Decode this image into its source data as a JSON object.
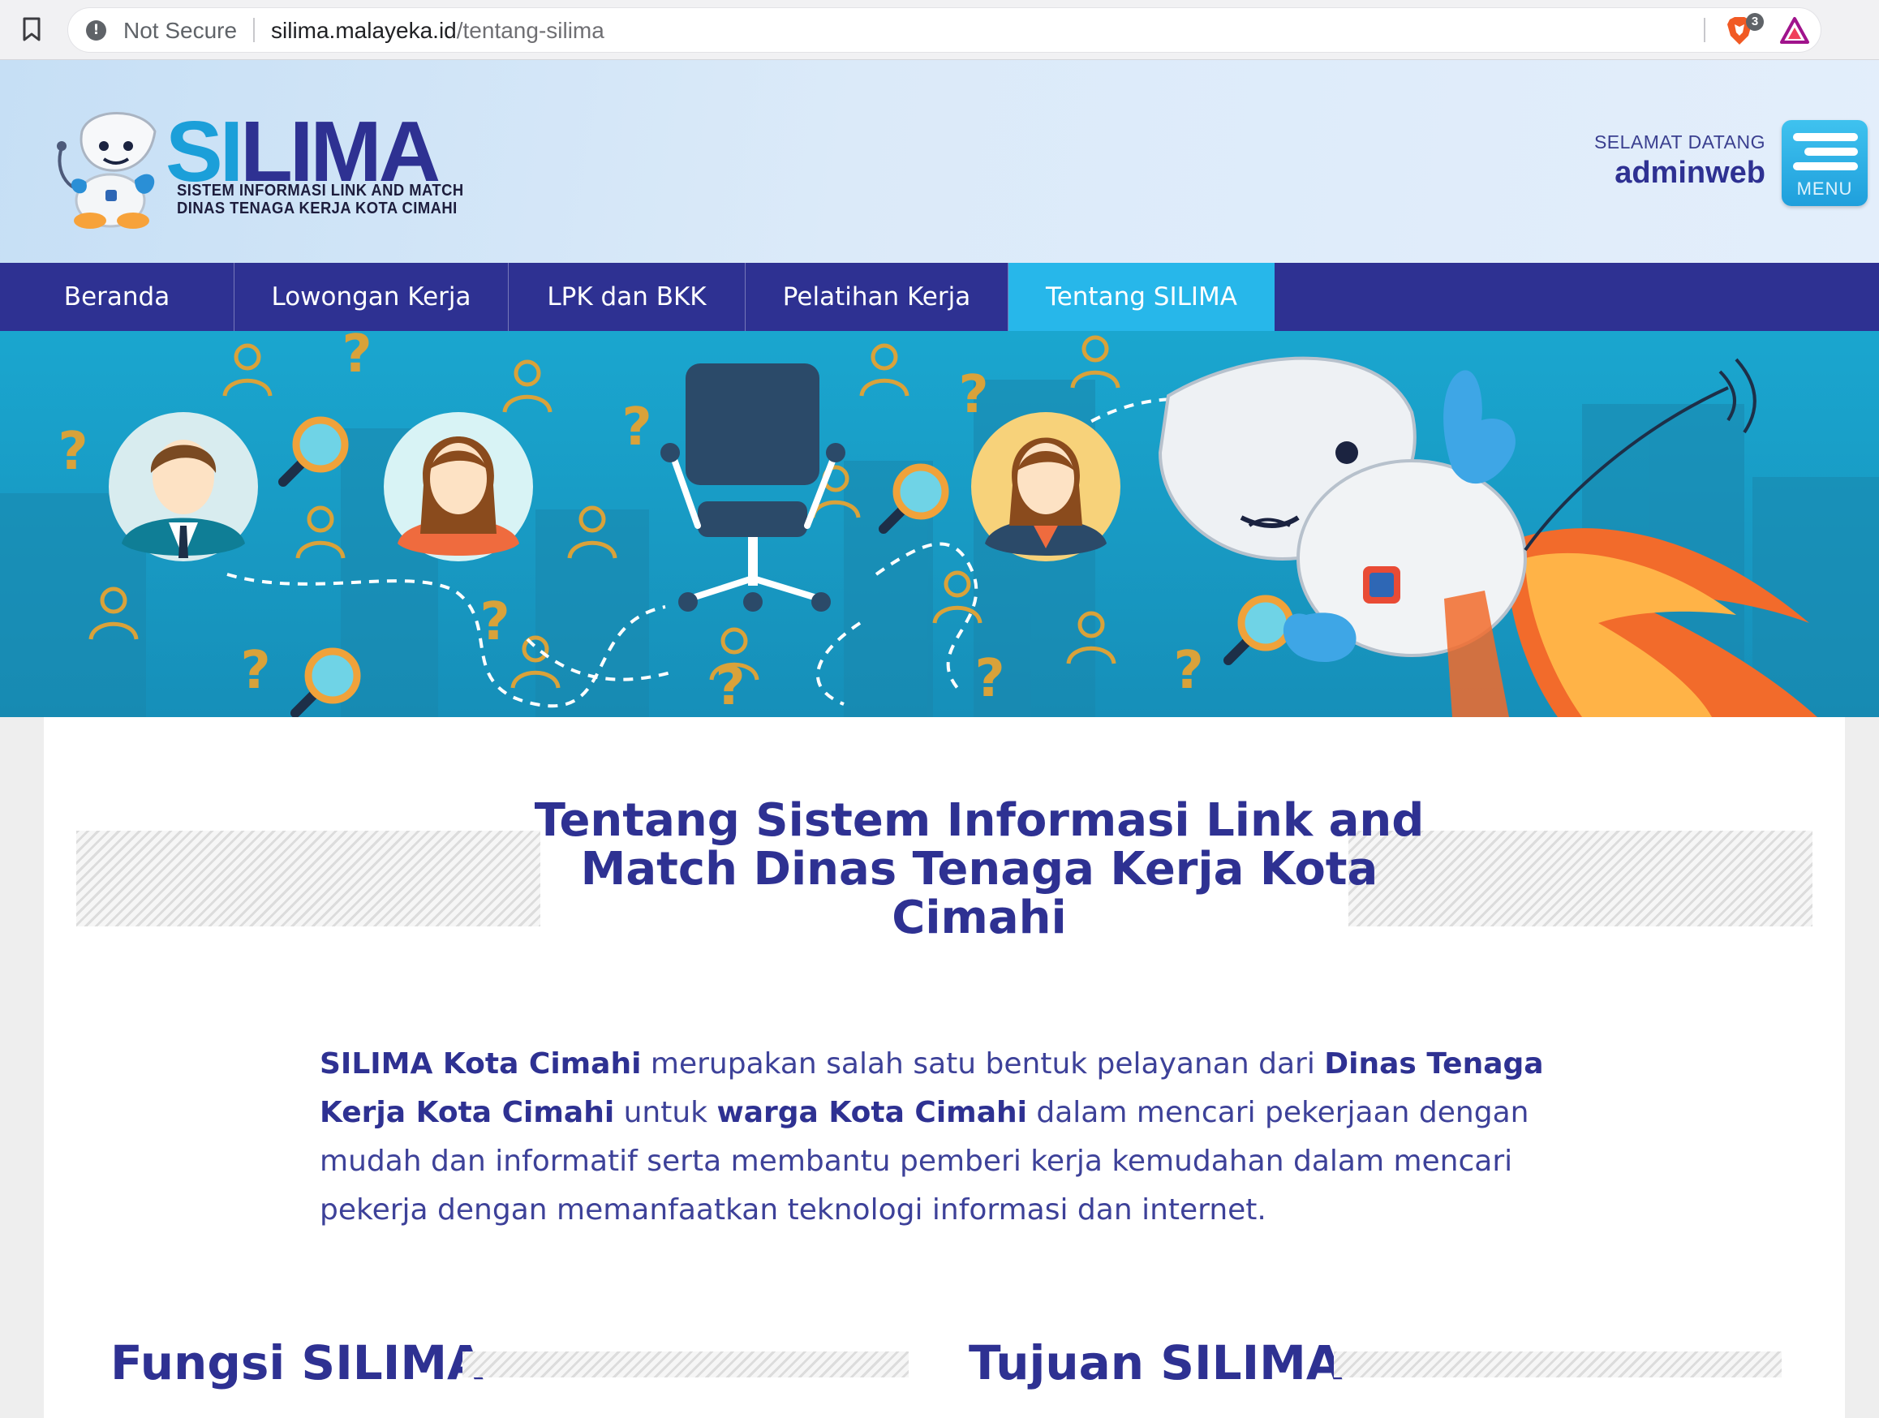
{
  "browser": {
    "security_label": "Not Secure",
    "url_host": "silima.malayeka.id",
    "url_path": "/tentang-silima",
    "brave_shield_count": "3"
  },
  "header": {
    "logo_text": "SILIMA",
    "logo_line1": "SISTEM INFORMASI LINK AND MATCH",
    "logo_line2": "DINAS TENAGA KERJA KOTA CIMAHI",
    "welcome_label": "SELAMAT DATANG",
    "username": "adminweb",
    "menu_label": "MENU"
  },
  "nav": {
    "items": [
      {
        "label": "Beranda"
      },
      {
        "label": "Lowongan Kerja"
      },
      {
        "label": "LPK dan BKK"
      },
      {
        "label": "Pelatihan Kerja"
      },
      {
        "label": "Tentang SILIMA",
        "active": true
      }
    ]
  },
  "main": {
    "title": "Tentang Sistem Informasi Link and Match Dinas Tenaga Kerja Kota Cimahi",
    "intro": {
      "b1": "SILIMA Kota Cimahi",
      "t1": " merupakan salah satu bentuk pelayanan dari ",
      "b2": "Dinas Tenaga Kerja Kota Cimahi",
      "t2": " untuk ",
      "b3": "warga Kota Cimahi",
      "t3": " dalam mencari pekerjaan dengan mudah dan informatif serta membantu pemberi kerja kemudahan dalam mencari pekerja dengan memanfaatkan teknologi informasi dan internet."
    },
    "sections": [
      {
        "title": "Fungsi SILIMA"
      },
      {
        "title": "Tujuan SILIMA"
      }
    ]
  },
  "colors": {
    "brand_navy": "#2e3192",
    "brand_cyan": "#27b7ea",
    "banner_blue": "#1f9cc4",
    "accent_orange": "#d9a23a"
  },
  "icons": [
    "bookmark-icon",
    "info-icon",
    "brave-shield-icon",
    "brave-rewards-icon",
    "hamburger-menu-icon"
  ]
}
